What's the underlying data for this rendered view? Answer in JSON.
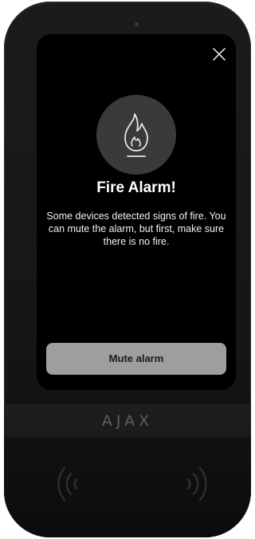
{
  "alarm": {
    "title": "Fire Alarm!",
    "message": "Some devices detected signs of fire. You can mute the alarm, but first, make sure there is no fire.",
    "mute_label": "Mute alarm",
    "icon": "flame-icon"
  },
  "device": {
    "brand": "AJAX",
    "close_icon": "close-icon",
    "nfc_icon": "nfc-reader-icon"
  },
  "colors": {
    "device_body": "#1b1b1d",
    "screen_bg": "#000000",
    "icon_circle": "#3a3a3c",
    "button_bg": "#9e9e9e",
    "button_text": "#1a1a1a",
    "text": "#ffffff",
    "logo": "#5e5e60"
  }
}
